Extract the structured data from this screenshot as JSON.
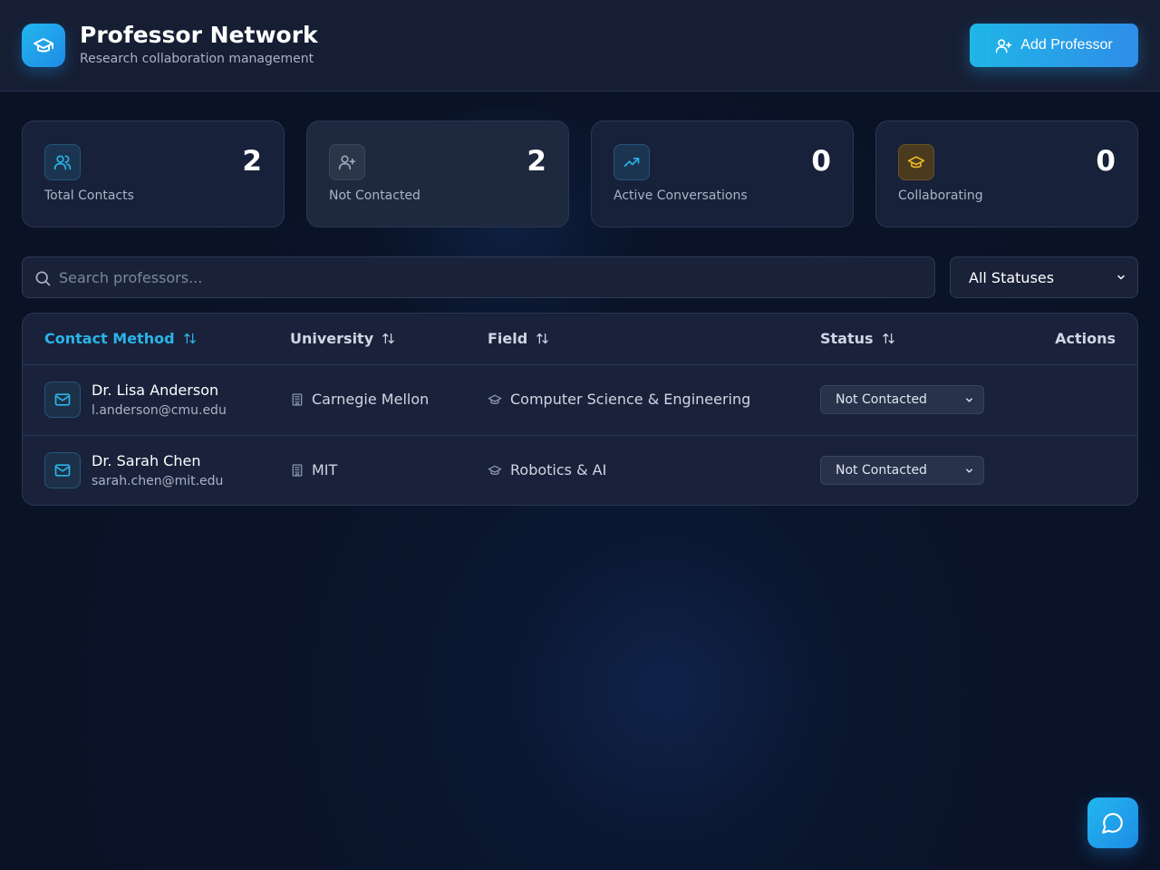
{
  "header": {
    "title": "Professor Network",
    "subtitle": "Research collaboration management",
    "add_button_label": "Add Professor",
    "logo_icon": "graduation-cap-icon",
    "add_icon": "user-plus-icon"
  },
  "stats": [
    {
      "label": "Total Contacts",
      "value": "2",
      "icon": "users-icon",
      "color": "#2bb4e8"
    },
    {
      "label": "Not Contacted",
      "value": "2",
      "icon": "user-plus-icon",
      "color": "#9aa6ba"
    },
    {
      "label": "Active Conversations",
      "value": "0",
      "icon": "trending-up-icon",
      "color": "#2bb4e8"
    },
    {
      "label": "Collaborating",
      "value": "0",
      "icon": "graduation-cap-icon",
      "color": "#f0b429"
    }
  ],
  "search": {
    "placeholder": "Search professors...",
    "value": ""
  },
  "filter": {
    "selected": "All Statuses"
  },
  "table": {
    "columns": [
      "Contact Method",
      "University",
      "Field",
      "Status",
      "Actions"
    ],
    "rows": [
      {
        "name": "Dr. Lisa Anderson",
        "email": "l.anderson@cmu.edu",
        "university": "Carnegie Mellon",
        "field": "Computer Science & Engineering",
        "status": "Not Contacted"
      },
      {
        "name": "Dr. Sarah Chen",
        "email": "sarah.chen@mit.edu",
        "university": "MIT",
        "field": "Robotics & AI",
        "status": "Not Contacted"
      }
    ]
  },
  "colors": {
    "accent": "#2bb4e8",
    "background": "#0b1224",
    "card": "#18213a"
  }
}
